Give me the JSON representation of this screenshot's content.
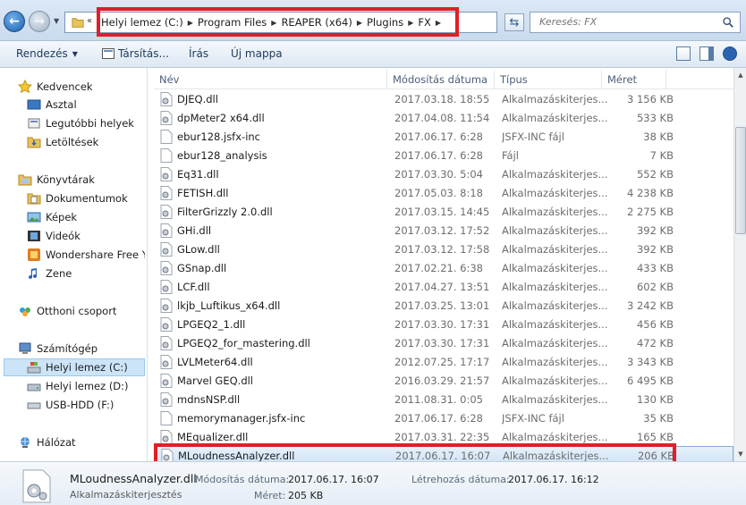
{
  "address": {
    "chevron": "«",
    "crumbs": [
      "Helyi lemez (C:)",
      "Program Files",
      "REAPER (x64)",
      "Plugins",
      "FX"
    ]
  },
  "search": {
    "placeholder": "Keresés: FX"
  },
  "toolbar": {
    "organize": "Rendezés",
    "associate": "Társítás...",
    "burn": "Írás",
    "new_folder": "Új mappa"
  },
  "nav": {
    "favorites": "Kedvencek",
    "desktop": "Asztal",
    "recent": "Legutóbbi helyek",
    "downloads": "Letöltések",
    "libraries": "Könyvtárak",
    "documents": "Dokumentumok",
    "pictures": "Képek",
    "videos": "Videók",
    "wondershare": "Wondershare Free Y",
    "music": "Zene",
    "homegroup": "Otthoni csoport",
    "computer": "Számítógép",
    "drive_c": "Helyi lemez (C:)",
    "drive_d": "Helyi lemez (D:)",
    "usb": "USB-HDD (F:)",
    "network": "Hálózat"
  },
  "columns": {
    "name": "Név",
    "date": "Módosítás dátuma",
    "type": "Típus",
    "size": "Méret"
  },
  "files": [
    {
      "name": "DJEQ.dll",
      "date": "2017.03.18. 18:55",
      "type": "Alkalmazáskiterjes...",
      "size": "3 156 KB",
      "icon": "dll"
    },
    {
      "name": "dpMeter2 x64.dll",
      "date": "2017.04.08. 11:54",
      "type": "Alkalmazáskiterjes...",
      "size": "533 KB",
      "icon": "dll"
    },
    {
      "name": "ebur128.jsfx-inc",
      "date": "2017.06.17. 6:28",
      "type": "JSFX-INC fájl",
      "size": "38 KB",
      "icon": "file"
    },
    {
      "name": "ebur128_analysis",
      "date": "2017.06.17. 6:28",
      "type": "Fájl",
      "size": "7 KB",
      "icon": "file"
    },
    {
      "name": "Eq31.dll",
      "date": "2017.03.30. 5:04",
      "type": "Alkalmazáskiterjes...",
      "size": "552 KB",
      "icon": "dll"
    },
    {
      "name": "FETISH.dll",
      "date": "2017.05.03. 8:18",
      "type": "Alkalmazáskiterjes...",
      "size": "4 238 KB",
      "icon": "dll"
    },
    {
      "name": "FilterGrizzly 2.0.dll",
      "date": "2017.03.15. 14:45",
      "type": "Alkalmazáskiterjes...",
      "size": "2 275 KB",
      "icon": "dll"
    },
    {
      "name": "GHi.dll",
      "date": "2017.03.12. 17:52",
      "type": "Alkalmazáskiterjes...",
      "size": "392 KB",
      "icon": "dll"
    },
    {
      "name": "GLow.dll",
      "date": "2017.03.12. 17:58",
      "type": "Alkalmazáskiterjes...",
      "size": "392 KB",
      "icon": "dll"
    },
    {
      "name": "GSnap.dll",
      "date": "2017.02.21. 6:38",
      "type": "Alkalmazáskiterjes...",
      "size": "433 KB",
      "icon": "dll"
    },
    {
      "name": "LCF.dll",
      "date": "2017.04.27. 13:51",
      "type": "Alkalmazáskiterjes...",
      "size": "602 KB",
      "icon": "dll"
    },
    {
      "name": "lkjb_Luftikus_x64.dll",
      "date": "2017.03.25. 13:01",
      "type": "Alkalmazáskiterjes...",
      "size": "3 242 KB",
      "icon": "dll"
    },
    {
      "name": "LPGEQ2_1.dll",
      "date": "2017.03.30. 17:31",
      "type": "Alkalmazáskiterjes...",
      "size": "456 KB",
      "icon": "dll"
    },
    {
      "name": "LPGEQ2_for_mastering.dll",
      "date": "2017.03.30. 17:31",
      "type": "Alkalmazáskiterjes...",
      "size": "472 KB",
      "icon": "dll"
    },
    {
      "name": "LVLMeter64.dll",
      "date": "2012.07.25. 17:17",
      "type": "Alkalmazáskiterjes...",
      "size": "3 343 KB",
      "icon": "dll"
    },
    {
      "name": "Marvel GEQ.dll",
      "date": "2016.03.29. 21:57",
      "type": "Alkalmazáskiterjes...",
      "size": "6 495 KB",
      "icon": "dll"
    },
    {
      "name": "mdnsNSP.dll",
      "date": "2011.08.31. 0:05",
      "type": "Alkalmazáskiterjes...",
      "size": "130 KB",
      "icon": "dll"
    },
    {
      "name": "memorymanager.jsfx-inc",
      "date": "2017.06.17. 6:28",
      "type": "JSFX-INC fájl",
      "size": "35 KB",
      "icon": "file"
    },
    {
      "name": "MEqualizer.dll",
      "date": "2017.03.31. 22:35",
      "type": "Alkalmazáskiterjes...",
      "size": "165 KB",
      "icon": "dll"
    },
    {
      "name": "MLoudnessAnalyzer.dll",
      "date": "2017.06.17. 16:07",
      "type": "Alkalmazáskiterjes...",
      "size": "206 KB",
      "icon": "dll",
      "selected": true
    }
  ],
  "details": {
    "name": "MLoudnessAnalyzer.dll",
    "type": "Alkalmazáskiterjesztés",
    "modified_label": "Módosítás dátuma:",
    "modified_value": "2017.06.17. 16:07",
    "created_label": "Létrehozás dátuma:",
    "created_value": "2017.06.17. 16:12",
    "size_label": "Méret:",
    "size_value": "205 KB"
  },
  "colors": {
    "highlight": "#e01f26",
    "selection": "#cfe3f6"
  }
}
